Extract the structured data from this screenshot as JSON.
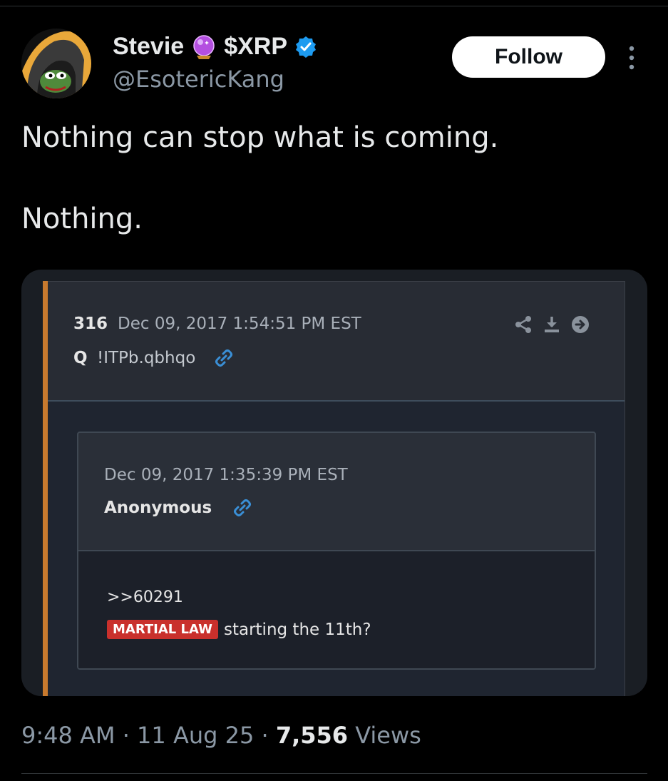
{
  "author": {
    "display_name": "Stevie",
    "ticker": "$XRP",
    "handle": "@EsotericKang",
    "follow_label": "Follow"
  },
  "tweet": {
    "lines": [
      "Nothing can stop what is coming.",
      "Nothing."
    ]
  },
  "embed": {
    "post": {
      "number": "316",
      "date": "Dec 09, 2017 1:54:51 PM EST",
      "author": "Q",
      "tripcode": "!ITPb.qbhqo"
    },
    "reply": {
      "date": "Dec 09, 2017 1:35:39 PM EST",
      "author": "Anonymous",
      "ref": ">>60291",
      "tag": "MARTIAL LAW",
      "text": "starting the 11th?"
    }
  },
  "meta": {
    "time": "9:48 AM",
    "date": "11 Aug 25",
    "views_count": "7,556",
    "views_label": "Views"
  },
  "icons": {
    "avatar": "hooded-frog-avatar",
    "badge": "crystal-ball-icon",
    "verified": "verified-badge-icon",
    "more": "more-options-icon"
  },
  "colors": {
    "background": "#000000",
    "follow_bg": "#ffffff",
    "verified": "#1d9bf0",
    "accent_bar": "#c87a2e",
    "tag_red": "#c9302c",
    "link_blue": "#3a8fd6"
  }
}
